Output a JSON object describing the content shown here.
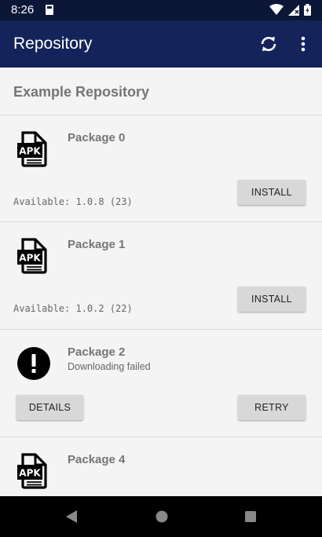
{
  "status_bar": {
    "time": "8:26"
  },
  "app_bar": {
    "title": "Repository",
    "icons": {
      "refresh": "refresh-icon",
      "more": "more-vert-icon"
    }
  },
  "repository": {
    "title": "Example Repository"
  },
  "packages": [
    {
      "name": "Package 0",
      "version_text": "Available: 1.0.8 (23)",
      "action_label": "INSTALL",
      "icon": "apk-file-icon"
    },
    {
      "name": "Package 1",
      "version_text": "Available: 1.0.2 (22)",
      "action_label": "INSTALL",
      "icon": "apk-file-icon"
    },
    {
      "name": "Package 2",
      "status": "Downloading failed",
      "secondary_action_label": "DETAILS",
      "action_label": "RETRY",
      "icon": "error-icon"
    },
    {
      "name": "Package 4",
      "icon": "apk-file-icon"
    }
  ],
  "colors": {
    "status_bar": "#0c1637",
    "app_bar": "#14245a",
    "background": "#f4f4f4",
    "button": "#d8d8d8",
    "title_text": "#757575"
  }
}
